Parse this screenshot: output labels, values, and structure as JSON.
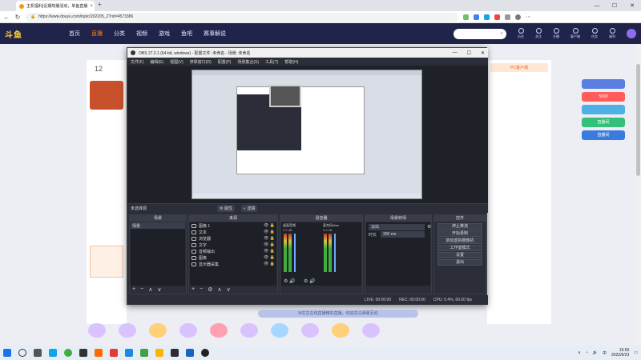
{
  "browser": {
    "tab_title": "主机福利|近期热播活动，单鱼直播",
    "tab_close": "×",
    "url": "https://www.douyu.com/topic/202205_Z?rid=4573386",
    "window_controls": {
      "minimize": "—",
      "maximize": "☐",
      "close": "✕"
    }
  },
  "douyu": {
    "logo": "斗鱼",
    "nav": [
      "首页",
      "直播",
      "分类",
      "视频",
      "游戏",
      "鱼吧",
      "赛事解说"
    ],
    "nav_active_index": 1,
    "search_icon": "search-icon",
    "header_icons": [
      "历史",
      "关注",
      "开播",
      "客户端",
      "任务",
      "福利"
    ],
    "left_count": "12",
    "right_badge": "PC客户端",
    "bottom_notice": "M先生在线直播精彩直播，欢迎关注弹幕互动",
    "promo_labels": [
      "5000",
      "直播间",
      "直播间"
    ]
  },
  "obs": {
    "title": "OBS 27.2.1 (64-bit, windows) - 配置文件: 未命名 - 场景: 未命名",
    "menu": [
      "文件(F)",
      "编辑(E)",
      "视图(V)",
      "停靠窗口(D)",
      "配置(P)",
      "场景集合(S)",
      "工具(T)",
      "帮助(H)"
    ],
    "no_source": "未选择源",
    "props_btn": "属性",
    "filter_btn": "滤镜",
    "docks": {
      "scenes": {
        "title": "场景",
        "items": [
          "场景"
        ]
      },
      "sources": {
        "title": "来源",
        "items": [
          "图像 1",
          "文本",
          "浏览器",
          "文字",
          "音频输出",
          "图像",
          "显示器采集"
        ]
      },
      "mixer": {
        "title": "混音器",
        "channels": [
          "桌面音频",
          "麦克风/Aux"
        ],
        "levels": [
          "0.0 dB",
          "0.0 dB"
        ]
      },
      "transitions": {
        "title": "场景转场",
        "type": "淡出",
        "duration_label": "时长",
        "duration": "300 ms"
      },
      "controls": {
        "title": "控件",
        "buttons": [
          "停止推流",
          "开始录制",
          "启动虚拟摄像机",
          "工作室模式",
          "设置",
          "退出"
        ]
      }
    },
    "status": {
      "live": "LIVE: 00:00:00",
      "rec": "REC: 00:00:00",
      "cpu": "CPU: 0.4%, 60.00 fps"
    }
  },
  "taskbar": {
    "time": "19:50",
    "date": "2022/6/23",
    "lang": "中"
  }
}
